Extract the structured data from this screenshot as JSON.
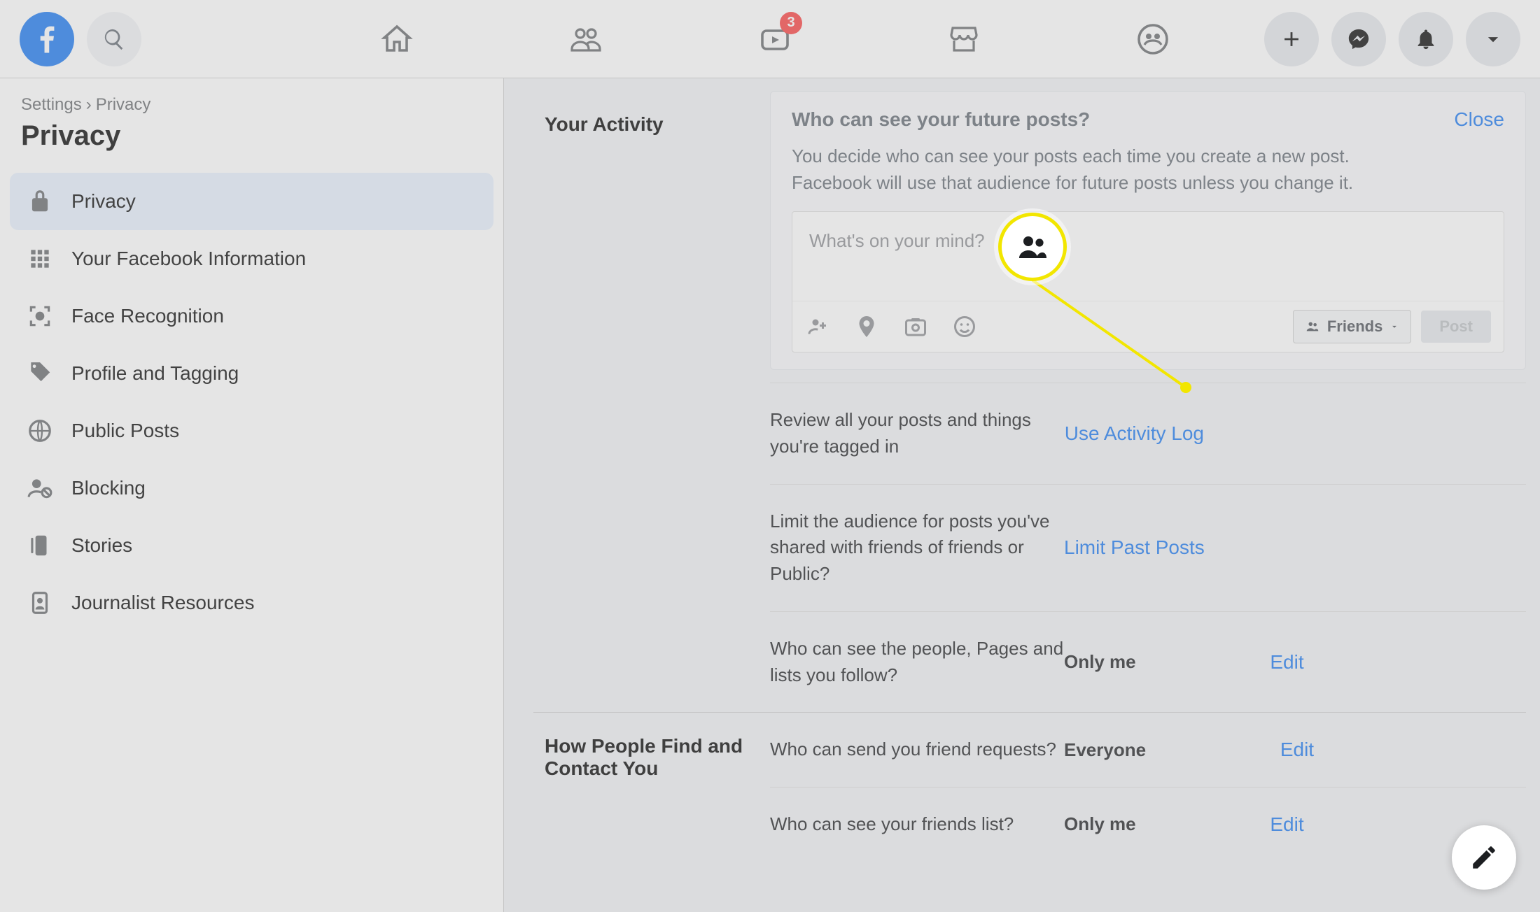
{
  "topnav": {
    "watch_badge": "3"
  },
  "breadcrumb": {
    "root": "Settings",
    "sep": "›",
    "current": "Privacy"
  },
  "page_title": "Privacy",
  "sidebar": {
    "items": [
      {
        "label": "Privacy"
      },
      {
        "label": "Your Facebook Information"
      },
      {
        "label": "Face Recognition"
      },
      {
        "label": "Profile and Tagging"
      },
      {
        "label": "Public Posts"
      },
      {
        "label": "Blocking"
      },
      {
        "label": "Stories"
      },
      {
        "label": "Journalist Resources"
      }
    ]
  },
  "sections": {
    "activity": {
      "heading": "Your Activity",
      "expanded": {
        "title": "Who can see your future posts?",
        "close": "Close",
        "desc": "You decide who can see your posts each time you create a new post. Facebook will use that audience for future posts unless you change it.",
        "composer_placeholder": "What's on your mind?",
        "audience_label": "Friends",
        "post_label": "Post"
      },
      "rows": [
        {
          "text": "Review all your posts and things you're tagged in",
          "value": "",
          "action": "Use Activity Log"
        },
        {
          "text": "Limit the audience for posts you've shared with friends of friends or Public?",
          "value": "",
          "action": "Limit Past Posts"
        },
        {
          "text": "Who can see the people, Pages and lists you follow?",
          "value": "Only me",
          "action": "Edit"
        }
      ]
    },
    "find": {
      "heading": "How People Find and Contact You",
      "rows": [
        {
          "text": "Who can send you friend requests?",
          "value": "Everyone",
          "action": "Edit"
        },
        {
          "text": "Who can see your friends list?",
          "value": "Only me",
          "action": "Edit"
        }
      ]
    }
  }
}
